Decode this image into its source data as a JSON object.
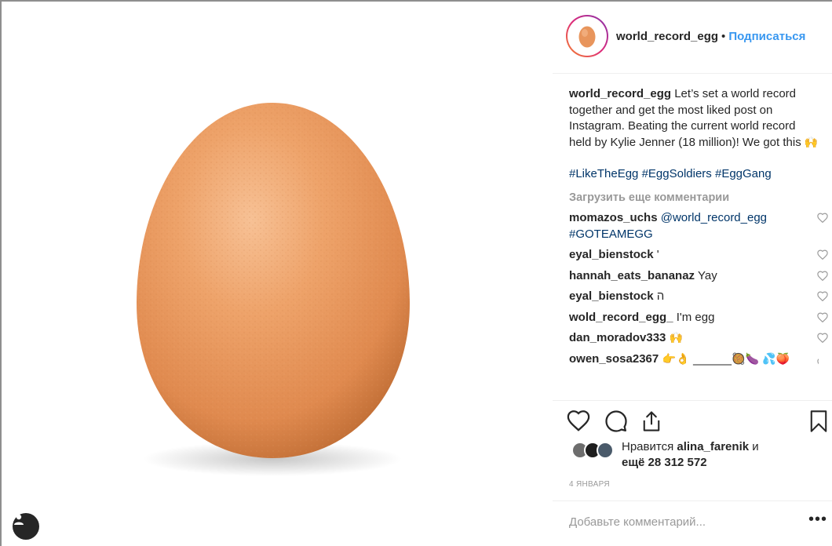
{
  "header": {
    "username": "world_record_egg",
    "separator": "•",
    "follow_label": "Подписаться"
  },
  "caption": {
    "author": "world_record_egg",
    "text": " Let’s set a world record together and get the most liked post on Instagram. Beating the current world record held by Kylie Jenner (18 million)! We got this ",
    "emoji": "🙌",
    "hashtags": [
      "#LikeTheEgg",
      "#EggSoldiers",
      "#EggGang"
    ]
  },
  "load_more_label": "Загрузить еще комментарии",
  "comments": [
    {
      "author": "momazos_uchs",
      "mention": "@world_record_egg",
      "text": "#GOTEAMEGG"
    },
    {
      "author": "eyal_bienstock",
      "mention": "",
      "text": " '"
    },
    {
      "author": "hannah_eats_bananaz",
      "mention": "",
      "text": " Yay"
    },
    {
      "author": "eyal_bienstock",
      "mention": "",
      "text": " ה"
    },
    {
      "author": "wold_record_egg_",
      "mention": "",
      "text": " I'm egg"
    },
    {
      "author": "dan_moradov333",
      "mention": "",
      "text": " 🙌"
    },
    {
      "author": "owen_sosa2367",
      "mention": "",
      "text": " 👉👌 _______🥘🍆 💦🍑"
    }
  ],
  "likes": {
    "prefix": "Нравится ",
    "liker": "alina_farenik",
    "suffix": " и",
    "more": "ещё 28 312 572"
  },
  "date": "4 ЯНВАРЯ",
  "add_comment_placeholder": "Добавьте комментарий...",
  "more_options": "•••",
  "colors": {
    "egg_light": "#f4b27e",
    "egg_mid": "#e8955c",
    "egg_dark": "#b8632e",
    "link": "#003569",
    "follow": "#3897f0",
    "muted": "#999999"
  }
}
